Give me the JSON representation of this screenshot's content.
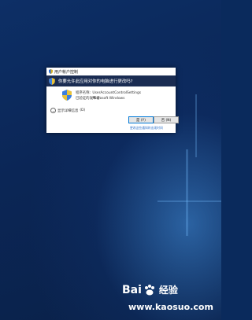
{
  "dialog": {
    "title": "用户帐户控制",
    "question": "你要允许此应用对你的电脑进行更改吗?",
    "program_name_label": "程序名称:",
    "program_name_value": "UserAccountControlSettings",
    "publisher_label": "已验证的发布者:",
    "publisher_value": "Microsoft Windows",
    "details_label": "显示详细信息",
    "details_suffix": "(D)",
    "yes_button": "是 (Y)",
    "no_button": "否 (N)",
    "link_text": "更改这些通知的出现时间"
  },
  "watermark": {
    "brand_left": "Bai",
    "brand_right": "经验",
    "url": "www.kaosuo.com"
  },
  "colors": {
    "question_band": "#1a2c52",
    "link": "#2a6fc9",
    "desktop": "#0a2a5c"
  }
}
